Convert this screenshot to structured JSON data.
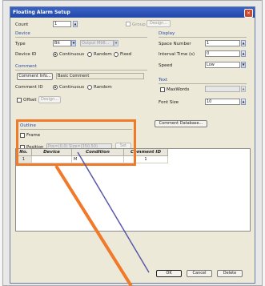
{
  "dialog": {
    "title": "Floating Alarm Setup",
    "close_glyph": "×"
  },
  "count": {
    "label": "Count",
    "value": "1",
    "group_label": "Group",
    "design_label": "Design..."
  },
  "device": {
    "section": "Device",
    "type_label": "Type",
    "type_value": "Bit",
    "type2_value": "Output M98...",
    "device_id_label": "Device ID",
    "mode_options": [
      "Continuous",
      "Random",
      "Fixed"
    ]
  },
  "display": {
    "section": "Display",
    "space_number_label": "Space Number",
    "space_number_value": "1",
    "interval_label": "Interval Time (s)",
    "interval_value": "0",
    "speed_label": "Speed",
    "speed_value": "Low"
  },
  "comment": {
    "section": "Comment",
    "info_button": "Comment Info...",
    "basic_label": "Basic Comment",
    "comment_id_label": "Comment ID",
    "id_options": [
      "Continuous",
      "Random"
    ],
    "offset_label": "Offset",
    "offset_design": "Design..."
  },
  "text": {
    "section": "Text",
    "maxwords_label": "MaxWords",
    "font_size_label": "Font Size",
    "font_size_value": "10",
    "database_button": "Comment Database..."
  },
  "outline": {
    "section": "Outline",
    "frame_label": "Frame",
    "position_label": "Position",
    "position_value": "Pos=(0,0) Size=(350,50)",
    "set_button": "Set"
  },
  "table": {
    "headers": [
      "No.",
      "Device",
      "Condition",
      "Comment ID"
    ],
    "rows": [
      [
        "1",
        "",
        "M",
        "1"
      ]
    ]
  },
  "buttons": {
    "ok": "OK",
    "cancel": "Cancel",
    "delete": "Delete"
  }
}
